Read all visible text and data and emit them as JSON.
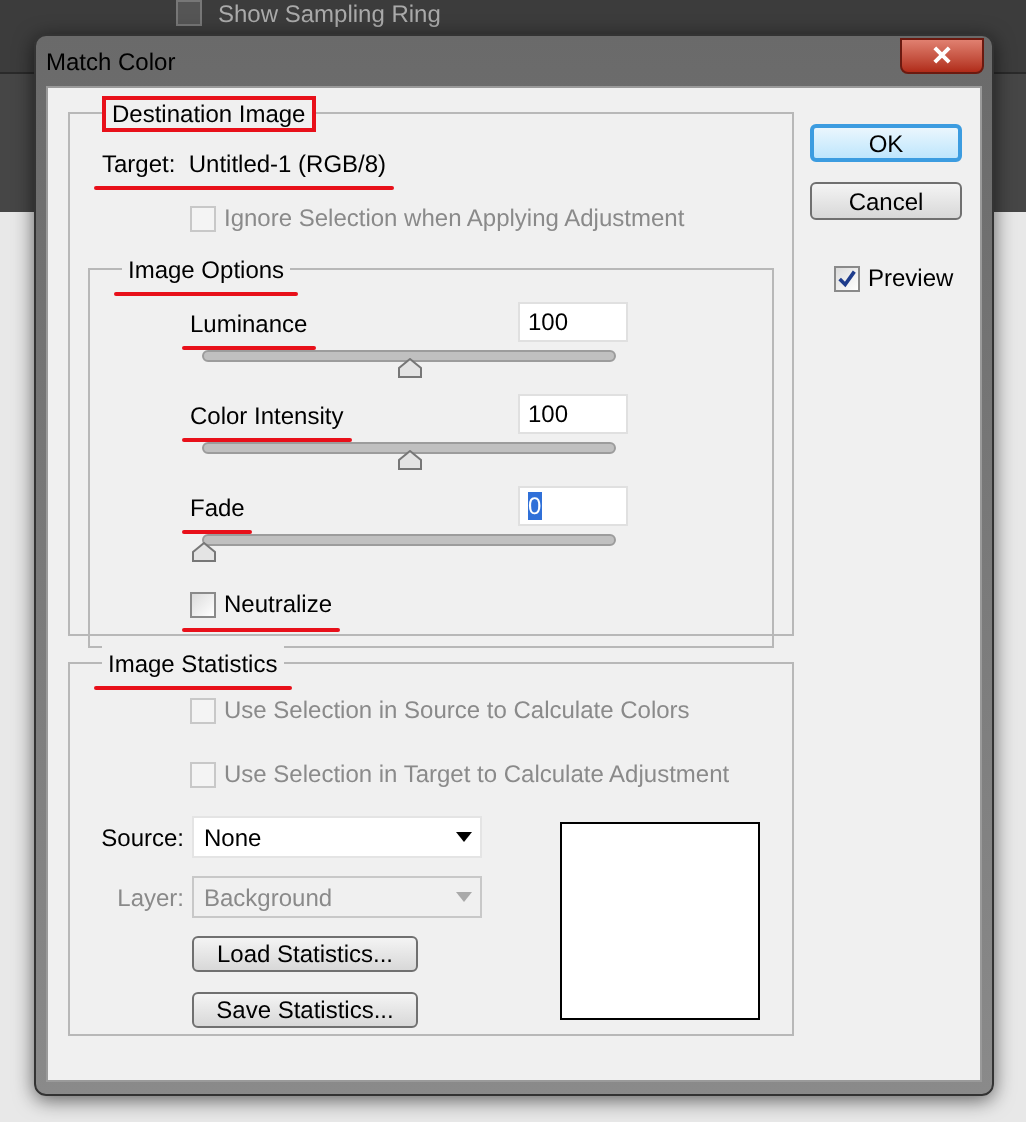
{
  "background_toolbar": {
    "checkbox_label": "Show Sampling Ring",
    "checked": false
  },
  "window": {
    "title": "Match Color"
  },
  "destination_image": {
    "legend": "Destination Image",
    "legend_boxed": true,
    "target": "Target:  Untitled-1 (RGB/8)",
    "target_underlined": true,
    "ignore_selection": {
      "label": "Ignore Selection when Applying Adjustment",
      "checked": false,
      "disabled": true
    }
  },
  "image_options": {
    "legend": "Image Options",
    "legend_underlined": true,
    "sliders": [
      {
        "label": "Luminance",
        "value": "100",
        "level": 0.5,
        "label_underlined": true,
        "value_selected": false
      },
      {
        "label": "Color Intensity",
        "value": "100",
        "level": 0.5,
        "label_underlined": true,
        "value_selected": false
      },
      {
        "label": "Fade",
        "value": "0",
        "level": 0,
        "label_underlined": true,
        "value_selected": true
      }
    ],
    "neutralize": {
      "label": "Neutralize",
      "checked": false,
      "underlined": true
    }
  },
  "image_statistics": {
    "legend": "Image Statistics",
    "legend_underlined": true,
    "options": [
      {
        "label": "Use Selection in Source to Calculate Colors",
        "checked": false,
        "disabled": true
      },
      {
        "label": "Use Selection in Target to Calculate Adjustment",
        "checked": false,
        "disabled": true
      }
    ],
    "source": {
      "label": "Source:",
      "value": "None",
      "disabled": false
    },
    "layer": {
      "label": "Layer:",
      "value": "Background",
      "disabled": true
    },
    "buttons": [
      "Load Statistics...",
      "Save Statistics..."
    ]
  },
  "buttons": [
    {
      "label": "OK",
      "default": true
    },
    {
      "label": "Cancel",
      "default": false
    }
  ],
  "preview": {
    "label": "Preview",
    "checked": true
  }
}
